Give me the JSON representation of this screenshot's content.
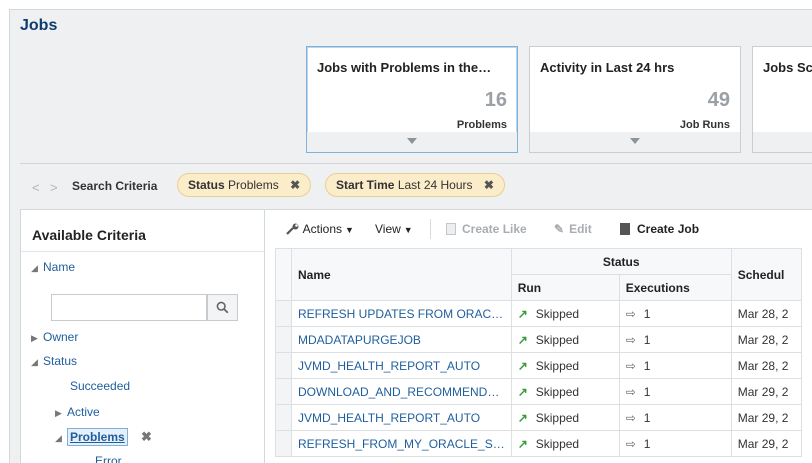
{
  "page": {
    "title": "Jobs"
  },
  "cards": [
    {
      "title": "Jobs with Problems in the…",
      "value": "16",
      "sub": "Problems"
    },
    {
      "title": "Activity in Last 24 hrs",
      "value": "49",
      "sub": "Job Runs"
    },
    {
      "title": "Jobs Sc"
    }
  ],
  "search": {
    "label": "Search Criteria",
    "chips": [
      {
        "key": "Status",
        "value": "Problems"
      },
      {
        "key": "Start Time",
        "value": "Last 24 Hours"
      }
    ],
    "remove_glyph": "✖"
  },
  "criteria": {
    "title": "Available Criteria",
    "name": "Name",
    "owner": "Owner",
    "status": "Status",
    "succeeded": "Succeeded",
    "active": "Active",
    "problems": "Problems",
    "error": "Error"
  },
  "toolbar": {
    "actions": "Actions",
    "view": "View",
    "create_like": "Create Like",
    "edit": "Edit",
    "create_job": "Create Job"
  },
  "table": {
    "headers": {
      "name": "Name",
      "status": "Status",
      "run": "Run",
      "executions": "Executions",
      "schedule": "Schedul"
    },
    "rows": [
      {
        "name": "REFRESH UPDATES FROM ORAC…",
        "run": "Skipped",
        "executions": "1",
        "schedule": "Mar 28, 2"
      },
      {
        "name": "MDADATAPURGEJOB",
        "run": "Skipped",
        "executions": "1",
        "schedule": "Mar 28, 2"
      },
      {
        "name": "JVMD_HEALTH_REPORT_AUTO",
        "run": "Skipped",
        "executions": "1",
        "schedule": "Mar 28, 2"
      },
      {
        "name": "DOWNLOAD_AND_RECOMMEND…",
        "run": "Skipped",
        "executions": "1",
        "schedule": "Mar 29, 2"
      },
      {
        "name": "JVMD_HEALTH_REPORT_AUTO",
        "run": "Skipped",
        "executions": "1",
        "schedule": "Mar 29, 2"
      },
      {
        "name": "REFRESH_FROM_MY_ORACLE_S…",
        "run": "Skipped",
        "executions": "1",
        "schedule": "Mar 29, 2"
      }
    ]
  }
}
